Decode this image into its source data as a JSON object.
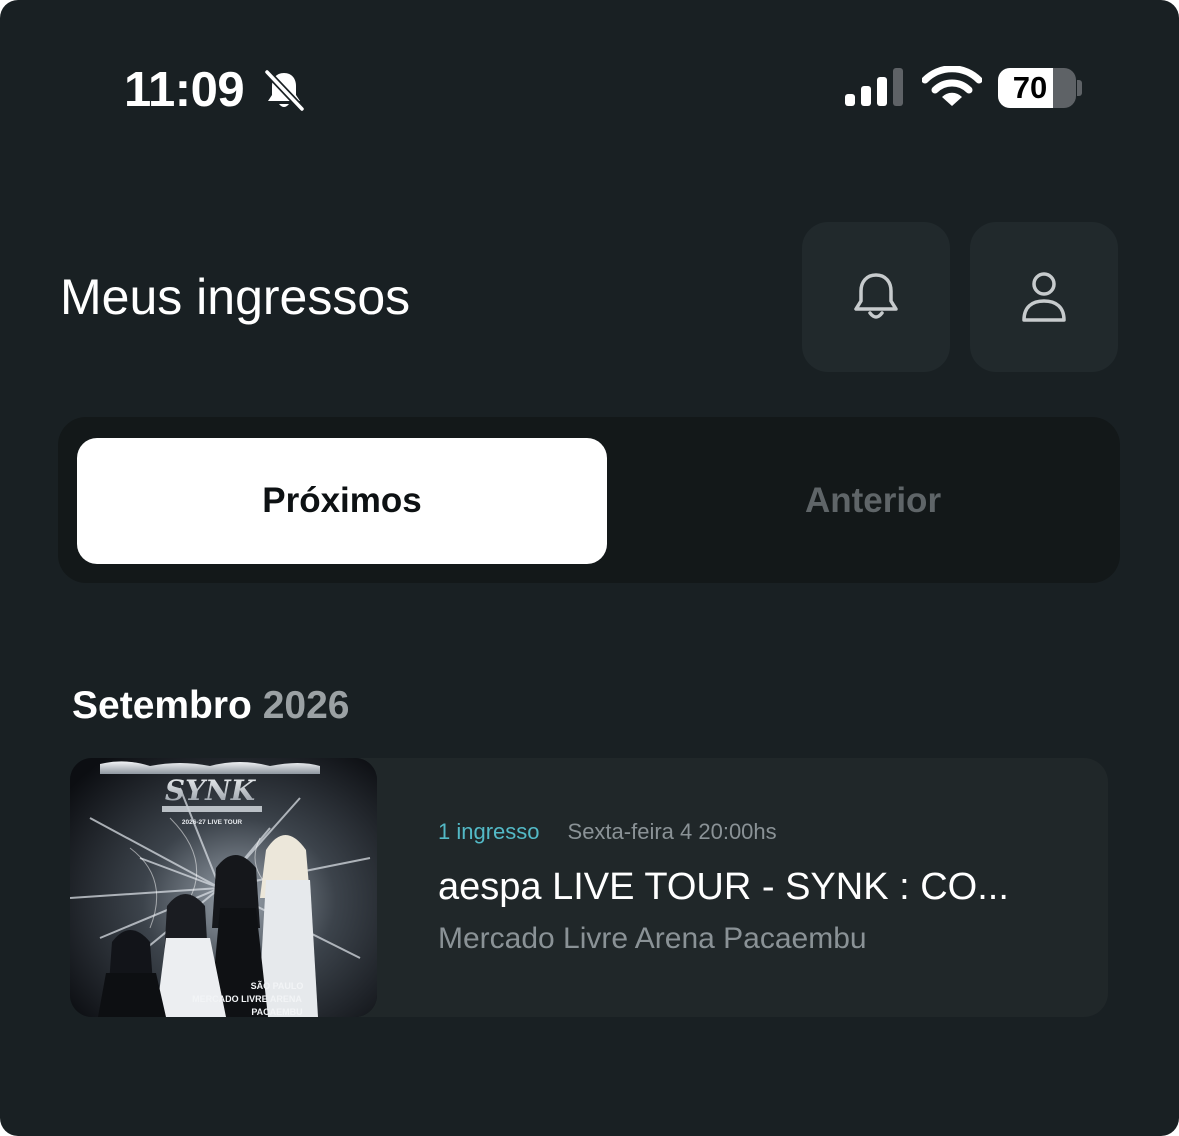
{
  "status_bar": {
    "time": "11:09",
    "battery_level": "70",
    "battery_fraction": 0.7
  },
  "header": {
    "title": "Meus ingressos"
  },
  "tabs": [
    {
      "label": "Próximos",
      "active": true
    },
    {
      "label": "Anterior",
      "active": false
    }
  ],
  "section": {
    "month": "Setembro",
    "year": "2026"
  },
  "event": {
    "ticket_count": "1 ingresso",
    "date": "Sexta-feira 4 20:00hs",
    "title": "aespa LIVE TOUR - SYNK : CO...",
    "venue": "Mercado Livre Arena Pacaembu",
    "poster": {
      "tour_label": "2026-27 LIVE TOUR",
      "city": "SÃO PAULO",
      "venue_line1": "MERCADO LIVRE ARENA",
      "venue_line2": "PACAEMBU"
    }
  },
  "colors": {
    "background": "#192023",
    "accent": "#53b9c6",
    "card": "#202729"
  }
}
